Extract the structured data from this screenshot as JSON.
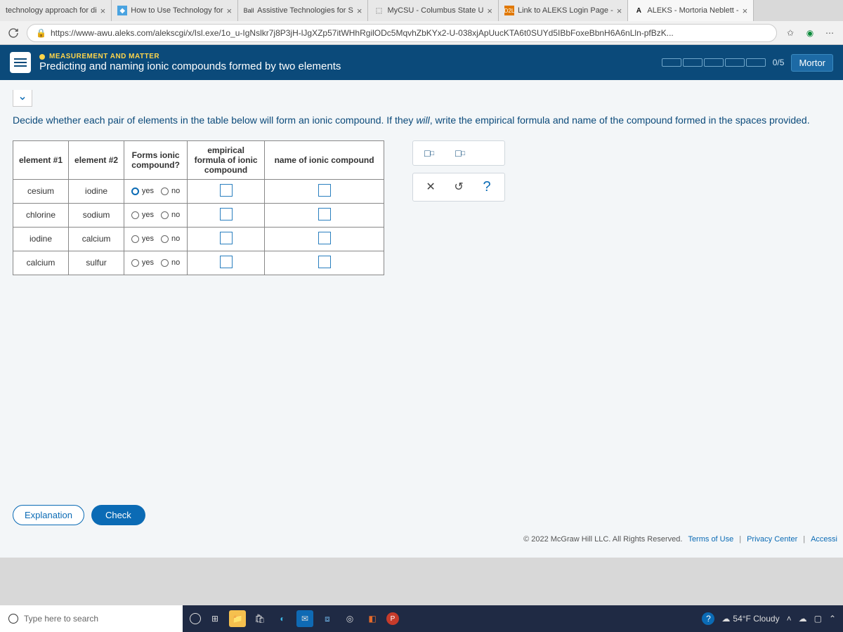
{
  "tabs": [
    {
      "label": "technology approach for di"
    },
    {
      "label": "How to Use Technology for"
    },
    {
      "label": "Assistive Technologies for S",
      "prefix": "Ball"
    },
    {
      "label": "MyCSU - Columbus State U"
    },
    {
      "label": "Link to ALEKS Login Page -",
      "prefix": "D2L"
    },
    {
      "label": "ALEKS - Mortoria Neblett -",
      "prefix": "A"
    }
  ],
  "url": "https://www-awu.aleks.com/alekscgi/x/Isl.exe/1o_u-IgNslkr7j8P3jH-lJgXZp57itWHhRgilODc5MqvhZbKYx2-U-038xjApUucKTA6t0SUYd5IBbFoxeBbnH6A6nLln-pfBzK...",
  "header": {
    "category": "MEASUREMENT AND MATTER",
    "title": "Predicting and naming ionic compounds formed by two elements",
    "score": "0/5",
    "student": "Mortor"
  },
  "prompt_a": "Decide whether each pair of elements in the table below will form an ionic compound. If they ",
  "prompt_em": "will",
  "prompt_b": ", write the empirical formula and name of the compound formed in the spaces provided.",
  "table": {
    "h1": "element #1",
    "h2": "element #2",
    "h3": "Forms ionic compound?",
    "h4": "empirical formula of ionic compound",
    "h5": "name of ionic compound",
    "yes": "yes",
    "no": "no",
    "rows": [
      {
        "e1": "cesium",
        "e2": "iodine",
        "sel": true
      },
      {
        "e1": "chlorine",
        "e2": "sodium",
        "sel": false
      },
      {
        "e1": "iodine",
        "e2": "calcium",
        "sel": false
      },
      {
        "e1": "calcium",
        "e2": "sulfur",
        "sel": false
      }
    ]
  },
  "buttons": {
    "explanation": "Explanation",
    "check": "Check"
  },
  "copyright": "© 2022 McGraw Hill LLC. All Rights Reserved.",
  "links": {
    "terms": "Terms of Use",
    "privacy": "Privacy Center",
    "access": "Accessi"
  },
  "taskbar": {
    "search": "Type here to search",
    "weather": "54°F Cloudy"
  }
}
